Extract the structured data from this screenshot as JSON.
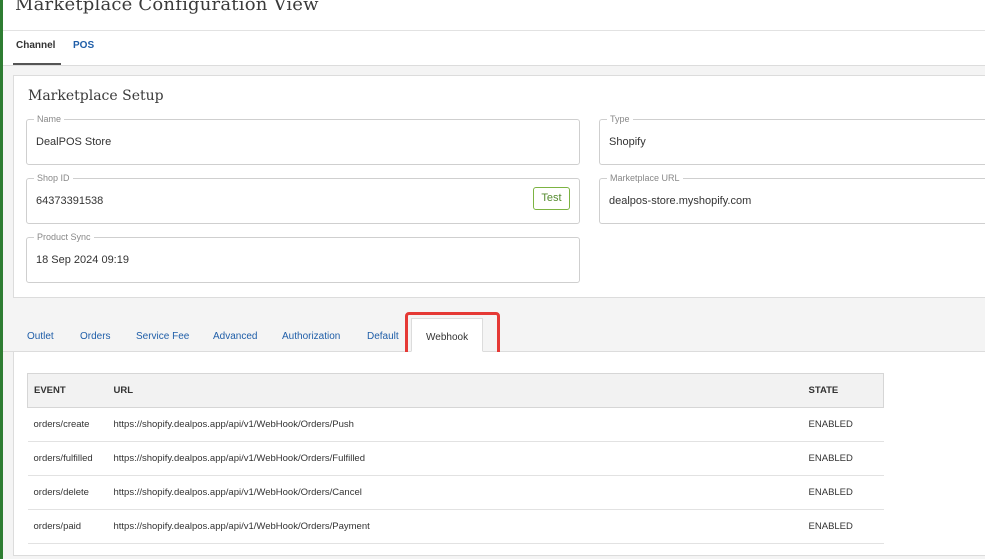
{
  "page": {
    "title": "Marketplace Configuration View"
  },
  "top_tabs": [
    {
      "label": "Channel",
      "active": true
    },
    {
      "label": "POS",
      "active": false
    }
  ],
  "setup": {
    "title": "Marketplace Setup",
    "name": {
      "label": "Name",
      "value": "DealPOS Store"
    },
    "type": {
      "label": "Type",
      "value": "Shopify"
    },
    "shop_id": {
      "label": "Shop ID",
      "value": "64373391538",
      "test_label": "Test"
    },
    "marketplace_url": {
      "label": "Marketplace URL",
      "value": "dealpos-store.myshopify.com"
    },
    "product_sync": {
      "label": "Product Sync",
      "value": "18 Sep 2024 09:19"
    }
  },
  "sub_tabs": [
    {
      "label": "Outlet",
      "active": false
    },
    {
      "label": "Orders",
      "active": false
    },
    {
      "label": "Service Fee",
      "active": false
    },
    {
      "label": "Advanced",
      "active": false
    },
    {
      "label": "Authorization",
      "active": false
    },
    {
      "label": "Default",
      "active": false
    },
    {
      "label": "Webhook",
      "active": true
    }
  ],
  "webhooks": {
    "columns": [
      "EVENT",
      "URL",
      "STATE"
    ],
    "rows": [
      {
        "event": "orders/create",
        "url": "https://shopify.dealpos.app/api/v1/WebHook/Orders/Push",
        "state": "ENABLED"
      },
      {
        "event": "orders/fulfilled",
        "url": "https://shopify.dealpos.app/api/v1/WebHook/Orders/Fulfilled",
        "state": "ENABLED"
      },
      {
        "event": "orders/delete",
        "url": "https://shopify.dealpos.app/api/v1/WebHook/Orders/Cancel",
        "state": "ENABLED"
      },
      {
        "event": "orders/paid",
        "url": "https://shopify.dealpos.app/api/v1/WebHook/Orders/Payment",
        "state": "ENABLED"
      }
    ]
  },
  "colors": {
    "accent_bar": "#2e7d32",
    "link": "#1f5ea8",
    "test_button": "#7cb342",
    "highlight": "#e53935"
  }
}
